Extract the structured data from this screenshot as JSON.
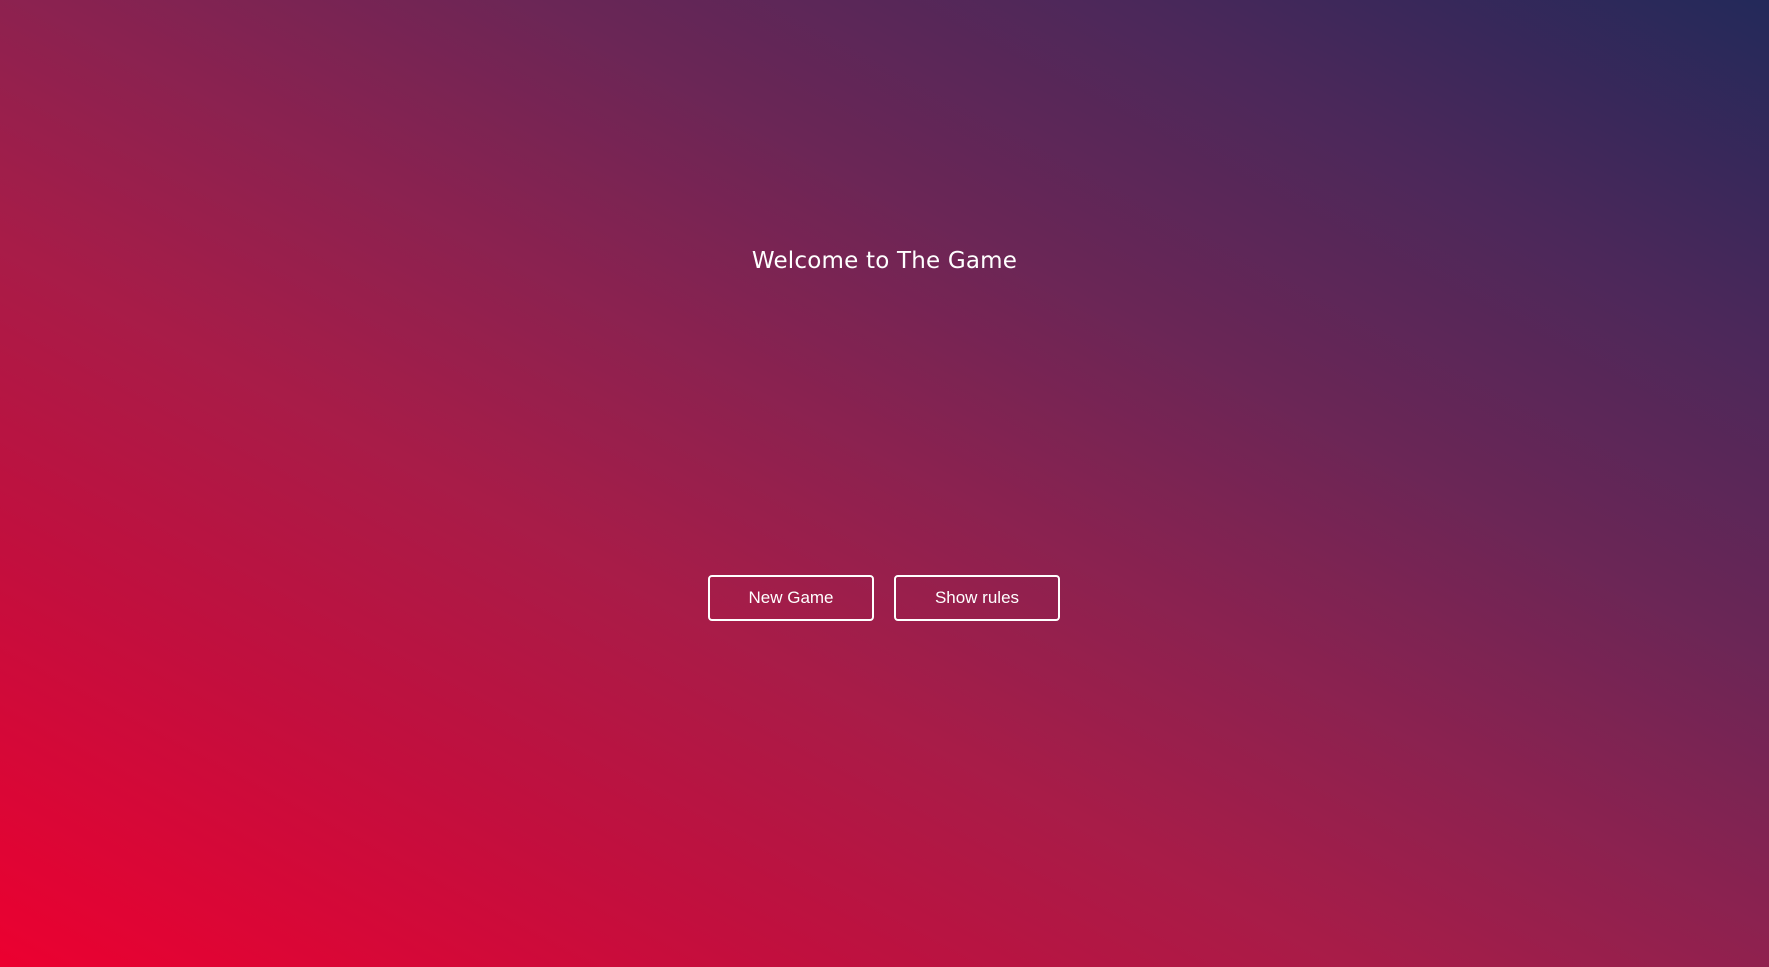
{
  "welcome": {
    "title": "Welcome to The Game"
  },
  "actions": {
    "new_game_label": "New Game",
    "show_rules_label": "Show rules"
  },
  "colors": {
    "gradient_start": "#ec0030",
    "gradient_end": "#23295a",
    "text": "#ffffff"
  }
}
